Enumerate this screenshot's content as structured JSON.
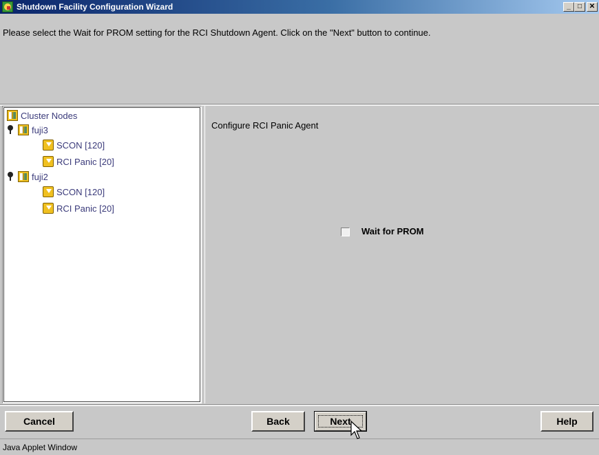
{
  "window": {
    "title": "Shutdown Facility Configuration Wizard",
    "controls": {
      "minimize": "_",
      "maximize": "□",
      "close": "✕"
    }
  },
  "instruction": "Please select the Wait for PROM setting for the RCI Shutdown Agent. Click on the \"Next\" button to continue.",
  "tree": {
    "root_label": "Cluster Nodes",
    "nodes": [
      {
        "label": "fuji3",
        "agents": [
          "SCON [120]",
          "RCI Panic [20]"
        ]
      },
      {
        "label": "fuji2",
        "agents": [
          "SCON [120]",
          "RCI Panic [20]"
        ]
      }
    ]
  },
  "config": {
    "title": "Configure RCI Panic Agent",
    "wait_for_prom_label": "Wait for PROM",
    "wait_for_prom_checked": false
  },
  "buttons": {
    "cancel": "Cancel",
    "back": "Back",
    "next": "Next",
    "help": "Help"
  },
  "status": "Java Applet Window",
  "icons": {
    "app": "java-coffee-icon",
    "node": "server-node-icon",
    "agent": "shutdown-agent-icon",
    "expand": "pin-expand-icon"
  }
}
